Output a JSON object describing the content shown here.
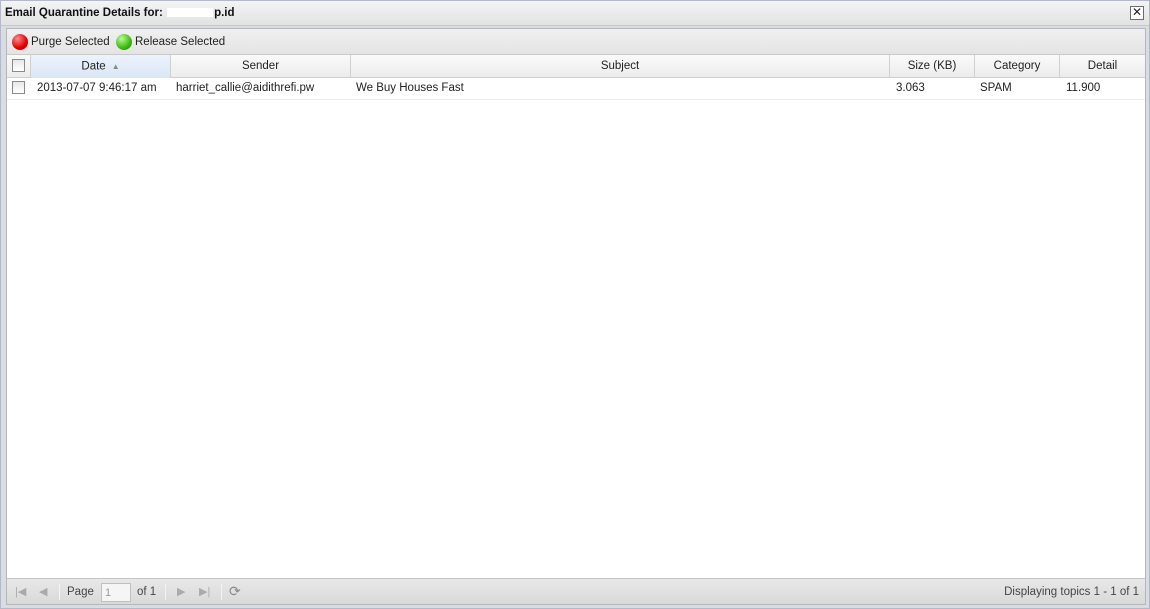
{
  "window": {
    "title_prefix": "Email Quarantine Details for:",
    "title_suffix": "p.id"
  },
  "toolbar": {
    "purge_label": "Purge Selected",
    "release_label": "Release Selected"
  },
  "grid": {
    "columns": {
      "date": "Date",
      "sender": "Sender",
      "subject": "Subject",
      "size": "Size (KB)",
      "category": "Category",
      "detail": "Detail"
    },
    "rows": [
      {
        "date": "2013-07-07 9:46:17 am",
        "sender": "harriet_callie@aidithrefi.pw",
        "subject": "We Buy Houses Fast",
        "size": "3.063",
        "category": "SPAM",
        "detail": "11.900"
      }
    ]
  },
  "paging": {
    "page_label": "Page",
    "page_value": "1",
    "of_label": "of 1",
    "display_text": "Displaying topics 1 - 1 of 1"
  },
  "colors": {
    "purge": "#e00000",
    "release": "#3cb814"
  }
}
